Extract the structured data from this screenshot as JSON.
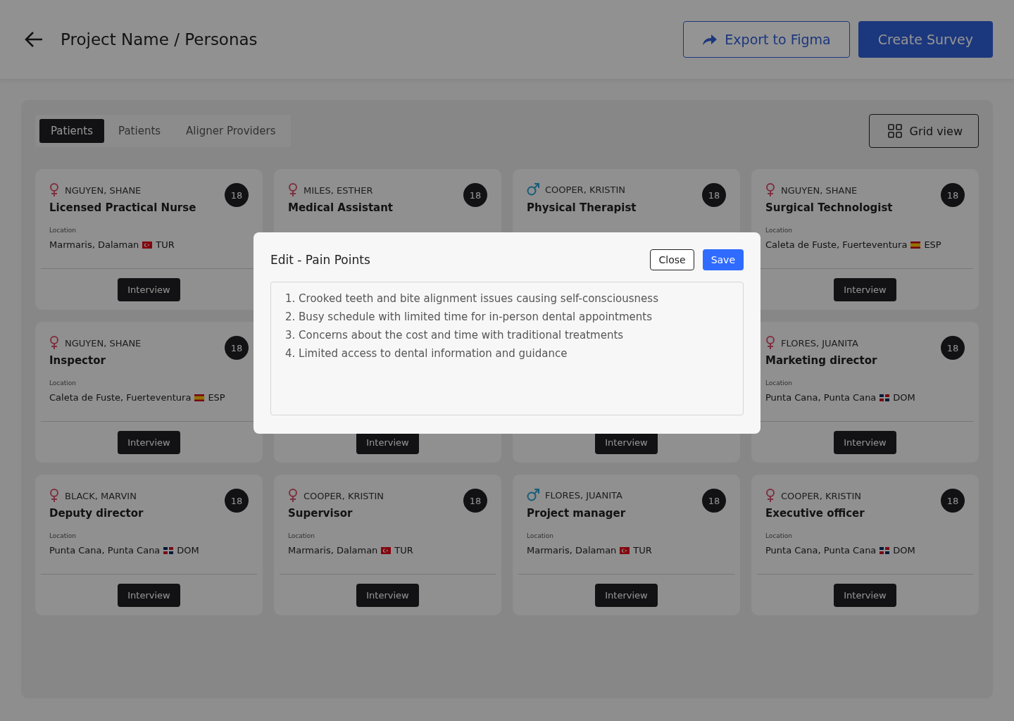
{
  "header": {
    "title": "Project Name / Personas",
    "export_button": "Export to Figma",
    "create_button": "Create Survey"
  },
  "tabs": [
    {
      "label": "Patients",
      "selected": true
    },
    {
      "label": "Patients",
      "selected": false
    },
    {
      "label": "Aligner Providers",
      "selected": false
    }
  ],
  "view_button": "Grid view",
  "cards": [
    {
      "gender_icon": {
        "kind": "female"
      },
      "name": "NGUYEN, SHANE",
      "age": "18",
      "title": "Licensed Practical Nurse",
      "location_label": "Location",
      "location": "Marmaris, Dalaman",
      "flag": {
        "kind": "turkey"
      },
      "country": "TUR",
      "button": "Interview"
    },
    {
      "gender_icon": {
        "kind": "female"
      },
      "name": "MILES, ESTHER",
      "age": "18",
      "title": "Medical Assistant"
    },
    {
      "gender_icon": {
        "kind": "male"
      },
      "name": "COOPER, KRISTIN",
      "age": "18",
      "title": "Physical Therapist"
    },
    {
      "gender_icon": {
        "kind": "female"
      },
      "name": "NGUYEN, SHANE",
      "age": "18",
      "title": "Surgical Technologist",
      "location_label": "Location",
      "location": "Caleta de Fuste, Fuerteventura",
      "flag": {
        "kind": "spain"
      },
      "country": "ESP",
      "button": "Interview"
    },
    {
      "gender_icon": {
        "kind": "female"
      },
      "name": "NGUYEN, SHANE",
      "age": "18",
      "title": "Inspector",
      "location_label": "Location",
      "location": "Caleta de Fuste, Fuerteventura",
      "flag": {
        "kind": "spain"
      },
      "country": "ESP",
      "button": "Interview"
    },
    {
      "button": "Interview"
    },
    {
      "button": "Interview"
    },
    {
      "gender_icon": {
        "kind": "female"
      },
      "name": "FLORES, JUANITA",
      "age": "18",
      "title": "Marketing director",
      "location_label": "Location",
      "location": "Punta Cana, Punta Cana",
      "flag": {
        "kind": "dominican"
      },
      "country": "DOM",
      "button": "Interview"
    },
    {
      "gender_icon": {
        "kind": "female"
      },
      "name": "BLACK, MARVIN",
      "age": "18",
      "title": "Deputy director",
      "location_label": "Location",
      "location": "Punta Cana, Punta Cana",
      "flag": {
        "kind": "dominican"
      },
      "country": "DOM",
      "button": "Interview"
    },
    {
      "gender_icon": {
        "kind": "female"
      },
      "name": "COOPER, KRISTIN",
      "age": "18",
      "title": "Supervisor",
      "location_label": "Location",
      "location": "Marmaris, Dalaman",
      "flag": {
        "kind": "turkey"
      },
      "country": "TUR",
      "button": "Interview"
    },
    {
      "gender_icon": {
        "kind": "male"
      },
      "name": "FLORES, JUANITA",
      "age": "18",
      "title": "Project manager",
      "location_label": "Location",
      "location": "Marmaris, Dalaman",
      "flag": {
        "kind": "turkey"
      },
      "country": "TUR",
      "button": "Interview"
    },
    {
      "gender_icon": {
        "kind": "female"
      },
      "name": "COOPER, KRISTIN",
      "age": "18",
      "title": "Executive officer",
      "location_label": "Location",
      "location": "Punta Cana, Punta Cana",
      "flag": {
        "kind": "dominican"
      },
      "country": "DOM",
      "button": "Interview"
    }
  ],
  "modal": {
    "title": "Edit - Pain Points",
    "close_button": "Close",
    "save_button": "Save",
    "items": [
      "1. Crooked teeth and bite alignment issues causing self-consciousness",
      "2. Busy schedule with limited time for in-person dental appointments",
      "3. Concerns about the cost and time with traditional treatments",
      "4. Limited access to dental information and guidance"
    ]
  }
}
